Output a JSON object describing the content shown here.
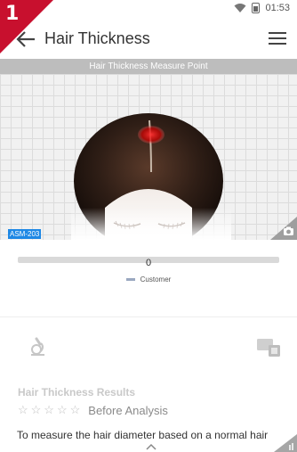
{
  "status": {
    "time": "01:53"
  },
  "badge": {
    "number": "1",
    "color": "#c8102e"
  },
  "appbar": {
    "title": "Hair Thickness"
  },
  "measure": {
    "header": "Hair Thickness Measure Point",
    "model_tag": "ASM-203"
  },
  "gauge": {
    "value": "0",
    "legend_label": "Customer"
  },
  "results": {
    "title": "Hair Thickness Results",
    "stars_filled": 0,
    "stars_total": 5,
    "stars_text": "☆☆☆☆☆",
    "rating_label": "Before Analysis",
    "description": "To measure the hair diameter based on a normal hair"
  },
  "icons": {
    "back": "back-arrow-icon",
    "menu": "hamburger-menu-icon",
    "camera": "camera-icon",
    "microscope": "microscope-icon",
    "device": "device-icon",
    "expand": "chevron-up-icon"
  }
}
